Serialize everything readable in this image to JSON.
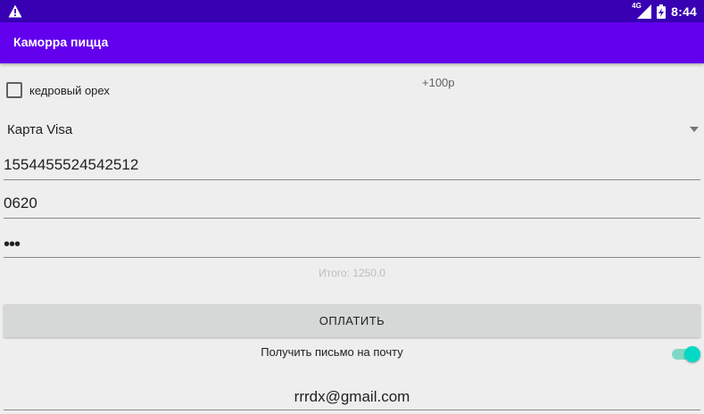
{
  "status_bar": {
    "network_type": "4G",
    "time": "8:44",
    "icons": [
      "warning-icon",
      "signal-icon",
      "battery-charging-icon"
    ]
  },
  "app_bar": {
    "title": "Каморра пицца"
  },
  "topping": {
    "label": "кедровый орех",
    "checked": false,
    "price": "+100р"
  },
  "payment": {
    "selected_method": "Карта Visa",
    "card_number": "1554455524542512",
    "expiry": "0620",
    "cvv_masked": "•••"
  },
  "total": {
    "text": "Итого: 1250.0"
  },
  "pay_button": {
    "label": "ОПЛАТИТЬ"
  },
  "email_option": {
    "label": "Получить письмо на почту",
    "enabled": true,
    "email": "rrrdx@gmail.com"
  },
  "colors": {
    "status_bar": "#3700b3",
    "app_bar": "#6200ee",
    "accent": "#03dac5",
    "background": "#eeeeee"
  }
}
